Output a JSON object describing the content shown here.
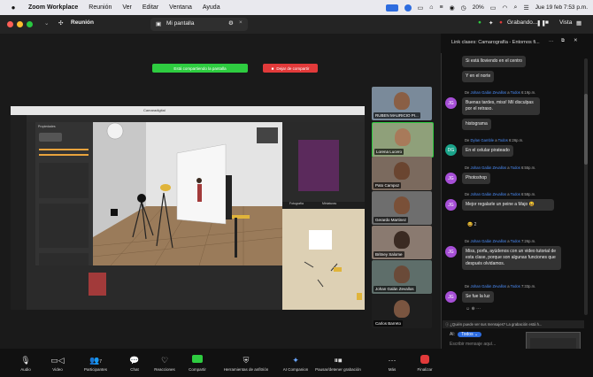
{
  "menubar": {
    "apple": "",
    "app": "Zoom Workplace",
    "items": [
      "Reunión",
      "Ver",
      "Editar",
      "Ventana",
      "Ayuda"
    ],
    "battery": "20%",
    "clock": "Jue 19 feb 7:53 p.m."
  },
  "titlebar": {
    "meeting_label": "Reunión",
    "tab_label": "Mi pantalla",
    "recording": "Grabando...",
    "view_label": "Vista"
  },
  "share_bar": {
    "banner": "Está compartiendo la pantalla",
    "stop": "Dejar de compartir"
  },
  "shared_app": {
    "window_title": "Camaradigital",
    "panel_props": "Propiedades",
    "panel_layers": "Capas",
    "tab_preview": "Fotografía",
    "tab_thumbs": "Miniaturas"
  },
  "gallery": [
    {
      "name": "RUBEN MAURICIO PI..."
    },
    {
      "name": "Lorena Lucero"
    },
    {
      "name": "Pato Campoz"
    },
    {
      "name": "Gerardo Martinez"
    },
    {
      "name": "Britney Salome"
    },
    {
      "name": "Johan Galán Zevallos"
    },
    {
      "name": "Carlos Barreto"
    }
  ],
  "chat": {
    "title": "Link clases: Camarografía - Entornos fi...",
    "messages": [
      {
        "type": "bubble",
        "text": "Si está lloviendo en el centro"
      },
      {
        "type": "bubble",
        "text": "Y en el norte"
      },
      {
        "type": "meta",
        "from": "Johan Galán Zevallos",
        "to": "Todos",
        "time": "6:19p.m."
      },
      {
        "type": "bubble",
        "text": "Buenas tardes, miss! Mil disculpas por el retraso."
      },
      {
        "type": "bubble",
        "text": "histograma"
      },
      {
        "type": "meta",
        "from": "Dylan Gamble",
        "to": "Todos",
        "time": "6:26p.m."
      },
      {
        "type": "bubble",
        "text": "En el celular pirateado"
      },
      {
        "type": "meta",
        "from": "Johan Galán Zevallos",
        "to": "Todos",
        "time": "6:55p.m."
      },
      {
        "type": "bubble",
        "text": "Photoshop"
      },
      {
        "type": "meta",
        "from": "Johan Galán Zevallos",
        "to": "Todos",
        "time": "6:58p.m."
      },
      {
        "type": "bubble",
        "text": "Mejor regalarle un peine a Majo 😆"
      },
      {
        "type": "meta",
        "from": "Johan Galán Zevallos",
        "to": "Todos",
        "time": "7:26p.m."
      },
      {
        "type": "bubble",
        "text": "Miss, porfa, ayúdenos con un video tutorial de esta clase, porque son algunas funciones que después olvidamos."
      },
      {
        "type": "meta",
        "from": "Johan Galán Zevallos",
        "to": "Todos",
        "time": "7:33p.m."
      },
      {
        "type": "bubble",
        "text": "Se fue la luz"
      }
    ],
    "reaction_count": "2",
    "notice": "¿Quién puede ver sus mensajes? La grabación está h...",
    "to_label": "Al:",
    "to_value": "Todos",
    "placeholder": "Escribir mensaje aquí..."
  },
  "avatars": {
    "jg_color": "#a64fd6",
    "dg_color": "#1aa38a"
  },
  "toolbar": {
    "items": [
      {
        "label": "Audio"
      },
      {
        "label": "Video"
      },
      {
        "label": "Participantes",
        "badge": "7"
      },
      {
        "label": "Chat"
      },
      {
        "label": "Reacciones"
      },
      {
        "label": "Compartir"
      },
      {
        "label": "Herramientas de anfitrión"
      },
      {
        "label": "AI Companion"
      },
      {
        "label": "Pausar/detener grabación"
      },
      {
        "label": "Más"
      },
      {
        "label": "Finalizar"
      }
    ]
  }
}
